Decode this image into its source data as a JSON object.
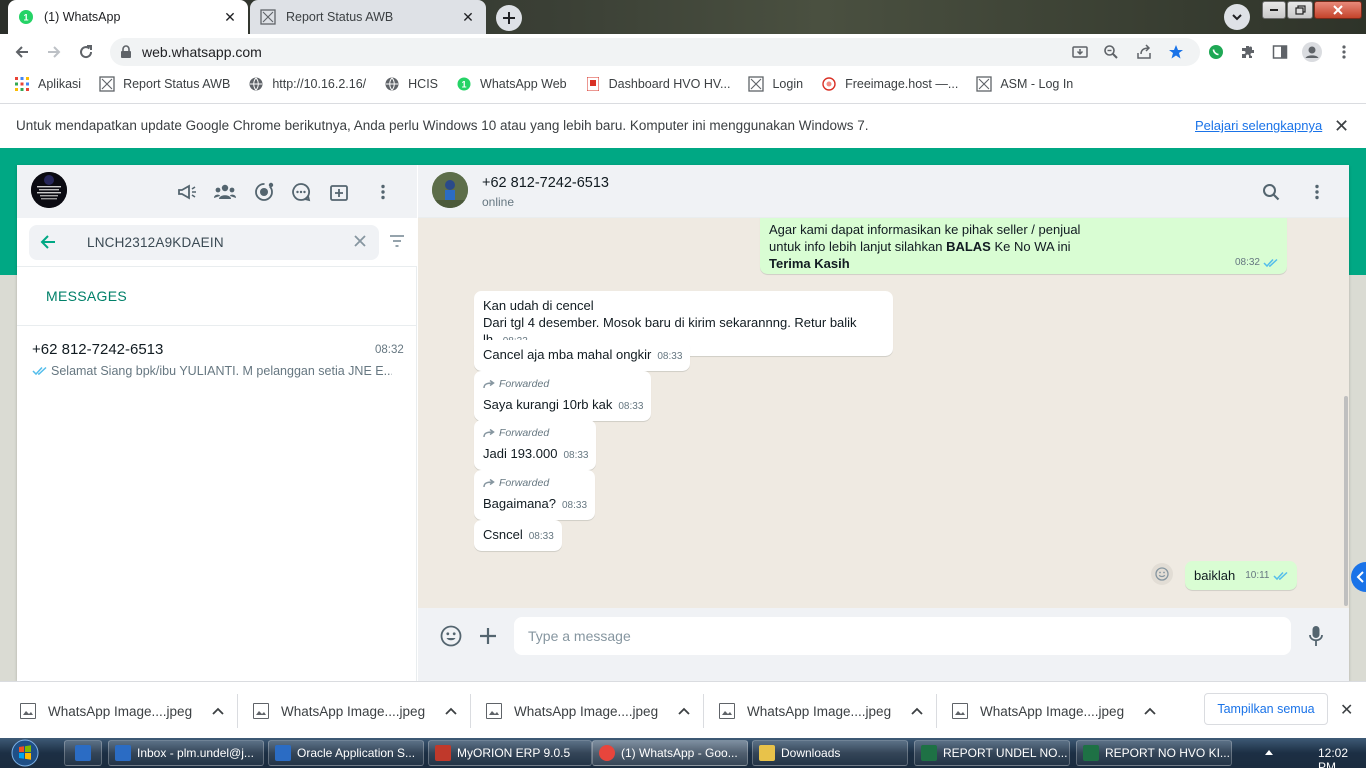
{
  "browser": {
    "tabs": [
      {
        "title": "(1) WhatsApp",
        "close": "✕"
      },
      {
        "title": "Report Status AWB",
        "close": "✕"
      }
    ],
    "url": "web.whatsapp.com",
    "bookmarks": [
      {
        "label": "Aplikasi",
        "icon": "apps-grid-icon"
      },
      {
        "label": "Report Status AWB",
        "icon": "page-icon"
      },
      {
        "label": "http://10.16.2.16/",
        "icon": "globe-icon"
      },
      {
        "label": "HCIS",
        "icon": "globe-icon"
      },
      {
        "label": "WhatsApp Web",
        "icon": "whatsapp-icon"
      },
      {
        "label": "Dashboard HVO HV...",
        "icon": "dashboard-icon"
      },
      {
        "label": "Login",
        "icon": "page-icon"
      },
      {
        "label": "Freeimage.host —...",
        "icon": "freeimage-icon"
      },
      {
        "label": "ASM - Log In",
        "icon": "page-icon"
      }
    ],
    "infobar": {
      "message": "Untuk mendapatkan update Google Chrome berikutnya, Anda perlu Windows 10 atau yang lebih baru. Komputer ini menggunakan Windows 7.",
      "link": "Pelajari selengkapnya",
      "close": "✕"
    }
  },
  "whatsapp": {
    "search": {
      "value": "LNCH2312A9KDAEIN"
    },
    "messages_label": "MESSAGES",
    "result": {
      "name": "+62 812-7242-6513",
      "time": "08:32",
      "preview": "Selamat Siang   bpk/ibu YULIANTI. M pelanggan setia JNE E..."
    },
    "chat": {
      "name": "+62 812-7242-6513",
      "status": "online",
      "first_out": {
        "line1": "Agar kami dapat informasikan ke pihak seller / penjual",
        "line2_pre": "untuk info lebih lanjut silahkan ",
        "line2_bold": "BALAS",
        "line2_post": " Ke No WA ini",
        "line3": "Terima Kasih",
        "time": "08:32"
      },
      "incoming": [
        {
          "lines": [
            "Kan udah di cencel",
            "Dari tgl 4 desember. Mosok baru di kirim sekarannng. Retur balik lh."
          ],
          "time": "08:33",
          "forwarded": false
        },
        {
          "lines": [
            "Cancel aja mba mahal ongkir"
          ],
          "time": "08:33",
          "forwarded": false
        },
        {
          "lines": [
            "Saya kurangi 10rb kak"
          ],
          "time": "08:33",
          "forwarded": true
        },
        {
          "lines": [
            "Jadi  193.000"
          ],
          "time": "08:33",
          "forwarded": true
        },
        {
          "lines": [
            "Bagaimana?"
          ],
          "time": "08:33",
          "forwarded": true
        },
        {
          "lines": [
            "Csncel"
          ],
          "time": "08:33",
          "forwarded": false
        }
      ],
      "forwarded_label": "Forwarded",
      "last_out": {
        "text": "baiklah",
        "time": "10:11"
      }
    },
    "composer": {
      "placeholder": "Type a message"
    }
  },
  "downloads": {
    "items": [
      "WhatsApp Image....jpeg",
      "WhatsApp Image....jpeg",
      "WhatsApp Image....jpeg",
      "WhatsApp Image....jpeg",
      "WhatsApp Image....jpeg"
    ],
    "show_all": "Tampilkan semua",
    "close": "✕"
  },
  "taskbar": {
    "items": [
      {
        "label": "Inbox - plm.undel@j...",
        "color": "#2b6cc4"
      },
      {
        "label": "Oracle Application S...",
        "color": "#2b6cc4"
      },
      {
        "label": "MyORION ERP 9.0.5",
        "color": "#c0392b"
      },
      {
        "label": "(1) WhatsApp - Goo...",
        "color": "#e8453c"
      },
      {
        "label": "Downloads",
        "color": "#e8c24a"
      },
      {
        "label": "REPORT UNDEL NO...",
        "color": "#1e7145"
      },
      {
        "label": "REPORT NO HVO KI...",
        "color": "#1e7145"
      }
    ],
    "clock": "12:02 PM"
  },
  "colors": {
    "accent": "#00a884",
    "outgoing_bubble": "#d9fdd3",
    "chat_bg": "#efeae2",
    "link": "#1a73e8"
  }
}
